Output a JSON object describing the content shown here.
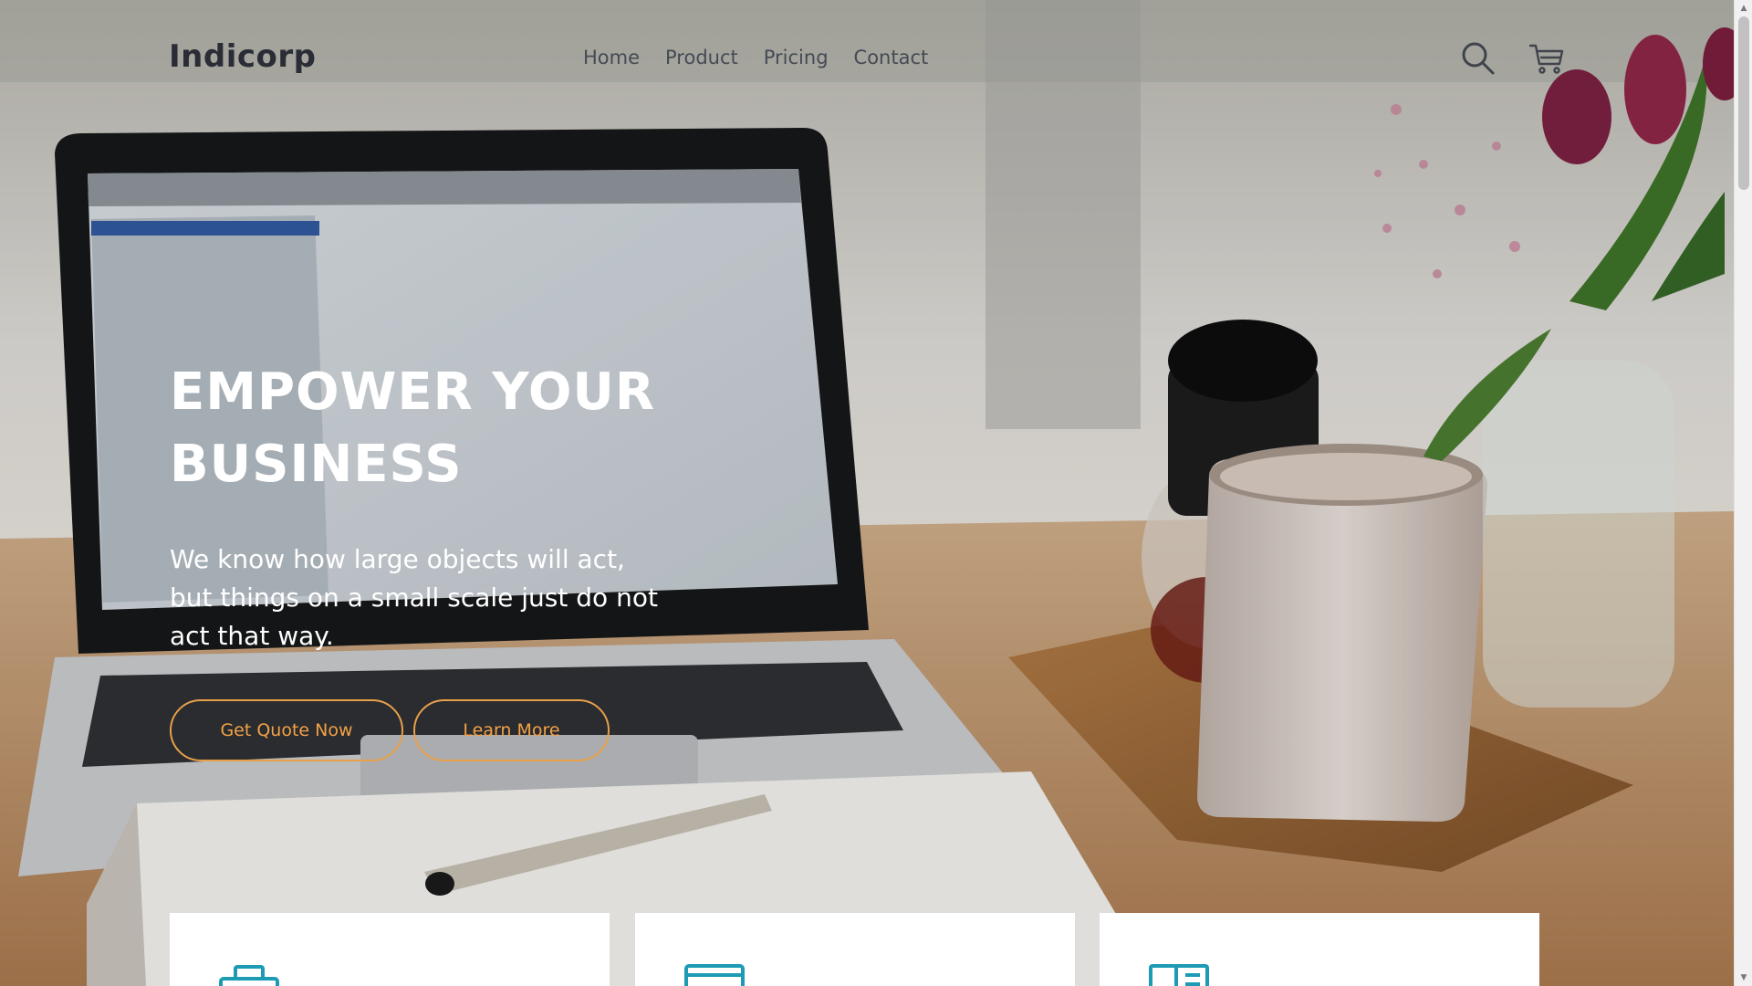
{
  "header": {
    "brand": "Indicorp",
    "nav": [
      "Home",
      "Product",
      "Pricing",
      "Contact"
    ]
  },
  "hero": {
    "title": "EMPOWER YOUR BUSINESS",
    "subtitle": "We know how large objects will act, but things on a small scale just do not act that way.",
    "buttons": {
      "quote": "Get Quote Now",
      "learn": "Learn More"
    }
  },
  "icons": {
    "search": "search-icon",
    "cart": "shopping-cart-icon",
    "card_1": "briefcase-icon",
    "card_2": "printer-icon",
    "card_3": "newspaper-icon"
  },
  "colors": {
    "brand_text": "#2a2d36",
    "nav_text": "#454a54",
    "accent": "#f3a146",
    "card_icon": "#1d9bb5",
    "hero_text": "#ffffff"
  }
}
